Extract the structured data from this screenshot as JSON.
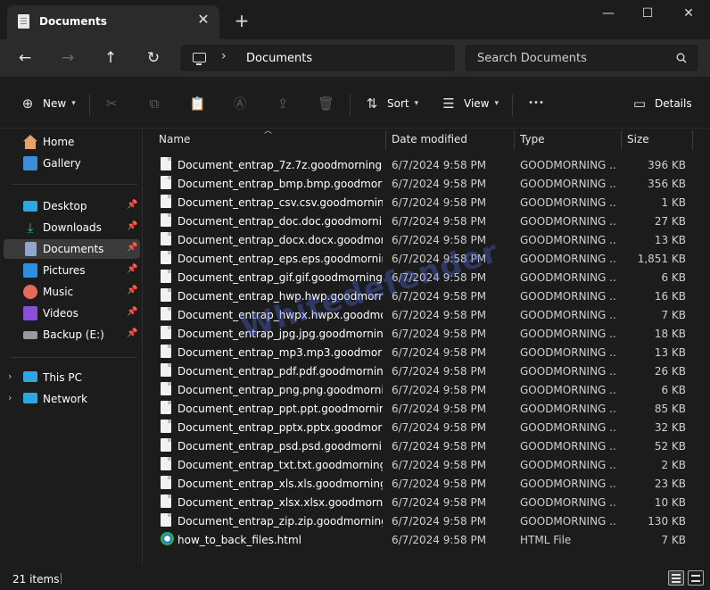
{
  "window": {
    "tab_title": "Documents",
    "tab_close": "✕",
    "new_tab": "+",
    "minimize": "—",
    "maximize": "☐",
    "close": "✕"
  },
  "nav": {
    "back": "←",
    "forward": "→",
    "up": "↑",
    "refresh": "↻",
    "address_chevron": "›",
    "address": "Documents",
    "search_placeholder": "Search Documents"
  },
  "commands": {
    "new_label": "New",
    "sort_label": "Sort",
    "view_label": "View",
    "more": "•••",
    "details_label": "Details"
  },
  "sidebar": {
    "pin": "📌",
    "items": [
      {
        "label": "Home",
        "icon": "home-icon",
        "color": "#e8a06a"
      },
      {
        "label": "Gallery",
        "icon": "gallery-icon",
        "color": "#3b8fd9"
      },
      {
        "label": "Desktop",
        "icon": "desktop-icon",
        "color": "#2ea7e0"
      },
      {
        "label": "Downloads",
        "icon": "downloads-icon",
        "color": "#3dbb8a"
      },
      {
        "label": "Documents",
        "icon": "documents-icon",
        "color": "#8fa7c8"
      },
      {
        "label": "Pictures",
        "icon": "pictures-icon",
        "color": "#2d8fe0"
      },
      {
        "label": "Music",
        "icon": "music-icon",
        "color": "#e66a5a"
      },
      {
        "label": "Videos",
        "icon": "videos-icon",
        "color": "#8a4fd8"
      },
      {
        "label": "Backup (E:)",
        "icon": "drive-icon",
        "color": "#9a9a9a"
      },
      {
        "label": "This PC",
        "icon": "this-pc-icon",
        "color": "#2ea7e0"
      },
      {
        "label": "Network",
        "icon": "network-icon",
        "color": "#2ea7e0"
      }
    ]
  },
  "columns": {
    "name": "Name",
    "date": "Date modified",
    "type": "Type",
    "size": "Size"
  },
  "files": [
    {
      "name": "Document_entrap_7z.7z.goodmorning",
      "date": "6/7/2024 9:58 PM",
      "type": "GOODMORNING ...",
      "size": "396 KB"
    },
    {
      "name": "Document_entrap_bmp.bmp.goodmorni...",
      "date": "6/7/2024 9:58 PM",
      "type": "GOODMORNING ...",
      "size": "356 KB"
    },
    {
      "name": "Document_entrap_csv.csv.goodmorning",
      "date": "6/7/2024 9:58 PM",
      "type": "GOODMORNING ...",
      "size": "1 KB"
    },
    {
      "name": "Document_entrap_doc.doc.goodmorning",
      "date": "6/7/2024 9:58 PM",
      "type": "GOODMORNING ...",
      "size": "27 KB"
    },
    {
      "name": "Document_entrap_docx.docx.goodmorn...",
      "date": "6/7/2024 9:58 PM",
      "type": "GOODMORNING ...",
      "size": "13 KB"
    },
    {
      "name": "Document_entrap_eps.eps.goodmorning",
      "date": "6/7/2024 9:58 PM",
      "type": "GOODMORNING ...",
      "size": "1,851 KB"
    },
    {
      "name": "Document_entrap_gif.gif.goodmorning",
      "date": "6/7/2024 9:58 PM",
      "type": "GOODMORNING ...",
      "size": "6 KB"
    },
    {
      "name": "Document_entrap_hwp.hwp.goodmorning",
      "date": "6/7/2024 9:58 PM",
      "type": "GOODMORNING ...",
      "size": "16 KB"
    },
    {
      "name": "Document_entrap_hwpx.hwpx.goodmor...",
      "date": "6/7/2024 9:58 PM",
      "type": "GOODMORNING ...",
      "size": "7 KB"
    },
    {
      "name": "Document_entrap_jpg.jpg.goodmorning",
      "date": "6/7/2024 9:58 PM",
      "type": "GOODMORNING ...",
      "size": "18 KB"
    },
    {
      "name": "Document_entrap_mp3.mp3.goodmorning",
      "date": "6/7/2024 9:58 PM",
      "type": "GOODMORNING ...",
      "size": "13 KB"
    },
    {
      "name": "Document_entrap_pdf.pdf.goodmorning",
      "date": "6/7/2024 9:58 PM",
      "type": "GOODMORNING ...",
      "size": "26 KB"
    },
    {
      "name": "Document_entrap_png.png.goodmorning",
      "date": "6/7/2024 9:58 PM",
      "type": "GOODMORNING ...",
      "size": "6 KB"
    },
    {
      "name": "Document_entrap_ppt.ppt.goodmorning",
      "date": "6/7/2024 9:58 PM",
      "type": "GOODMORNING ...",
      "size": "85 KB"
    },
    {
      "name": "Document_entrap_pptx.pptx.goodmorni...",
      "date": "6/7/2024 9:58 PM",
      "type": "GOODMORNING ...",
      "size": "32 KB"
    },
    {
      "name": "Document_entrap_psd.psd.goodmorning",
      "date": "6/7/2024 9:58 PM",
      "type": "GOODMORNING ...",
      "size": "52 KB"
    },
    {
      "name": "Document_entrap_txt.txt.goodmorning",
      "date": "6/7/2024 9:58 PM",
      "type": "GOODMORNING ...",
      "size": "2 KB"
    },
    {
      "name": "Document_entrap_xls.xls.goodmorning",
      "date": "6/7/2024 9:58 PM",
      "type": "GOODMORNING ...",
      "size": "23 KB"
    },
    {
      "name": "Document_entrap_xlsx.xlsx.goodmorning",
      "date": "6/7/2024 9:58 PM",
      "type": "GOODMORNING ...",
      "size": "10 KB"
    },
    {
      "name": "Document_entrap_zip.zip.goodmorning",
      "date": "6/7/2024 9:58 PM",
      "type": "GOODMORNING ...",
      "size": "130 KB"
    },
    {
      "name": "how_to_back_files.html",
      "date": "6/7/2024 9:58 PM",
      "type": "HTML File",
      "size": "7 KB"
    }
  ],
  "status": {
    "item_count": "21 items"
  },
  "watermark": "Whitedefender"
}
